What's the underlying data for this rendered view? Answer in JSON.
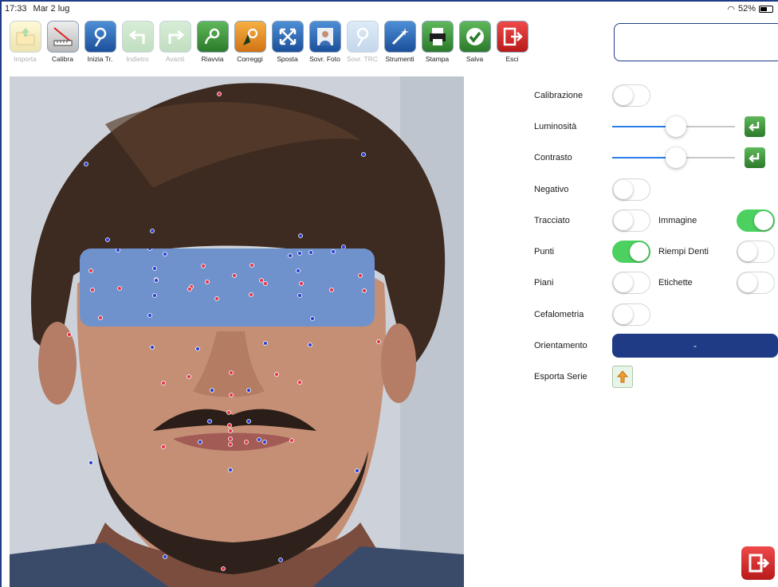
{
  "status": {
    "time": "17:33",
    "date": "Mar 2 lug",
    "battery": "52%"
  },
  "toolbar": [
    {
      "label": "Importa",
      "icon": "import-folder-icon",
      "disabled": true
    },
    {
      "label": "Calibra",
      "icon": "calibrate-ruler-icon",
      "disabled": false
    },
    {
      "label": "Inizia Tr.",
      "icon": "start-tracing-icon",
      "disabled": false
    },
    {
      "label": "Indietro",
      "icon": "undo-arrow-icon",
      "disabled": true
    },
    {
      "label": "Avanti",
      "icon": "redo-arrow-icon",
      "disabled": true
    },
    {
      "label": "Riavvia",
      "icon": "restart-icon",
      "disabled": false
    },
    {
      "label": "Correggi",
      "icon": "correct-cursor-icon",
      "disabled": false
    },
    {
      "label": "Sposta",
      "icon": "move-arrows-icon",
      "disabled": false
    },
    {
      "label": "Sovr. Foto",
      "icon": "overlay-photo-icon",
      "disabled": false
    },
    {
      "label": "Sovr. TRC",
      "icon": "overlay-trc-icon",
      "disabled": true
    },
    {
      "label": "Strumenti",
      "icon": "tools-wand-icon",
      "disabled": false
    },
    {
      "label": "Stampa",
      "icon": "printer-icon",
      "disabled": false
    },
    {
      "label": "Salva",
      "icon": "save-check-icon",
      "disabled": false
    },
    {
      "label": "Esci",
      "icon": "exit-door-icon",
      "disabled": false
    }
  ],
  "panel": {
    "calibrazione": {
      "label": "Calibrazione",
      "on": false
    },
    "luminosita": {
      "label": "Luminosità",
      "value": 0.52
    },
    "contrasto": {
      "label": "Contrasto",
      "value": 0.52
    },
    "negativo": {
      "label": "Negativo",
      "on": false
    },
    "tracciato": {
      "label": "Tracciato",
      "on": false
    },
    "immagine": {
      "label": "Immagine",
      "on": true
    },
    "punti": {
      "label": "Punti",
      "on": true
    },
    "riempi_denti": {
      "label": "Riempi Denti",
      "on": false
    },
    "piani": {
      "label": "Piani",
      "on": false
    },
    "etichette": {
      "label": "Etichette",
      "on": false
    },
    "cefalometria": {
      "label": "Cefalometria",
      "on": false
    },
    "orientamento": {
      "label": "Orientamento",
      "value": "-"
    },
    "esporta_serie": {
      "label": "Esporta Serie"
    }
  },
  "colors": {
    "accent": "#1f3b85",
    "switch_on": "#4cd160",
    "point_red": "#e8344a",
    "point_blue": "#2c3fd6",
    "mask": "#6f92cc"
  }
}
